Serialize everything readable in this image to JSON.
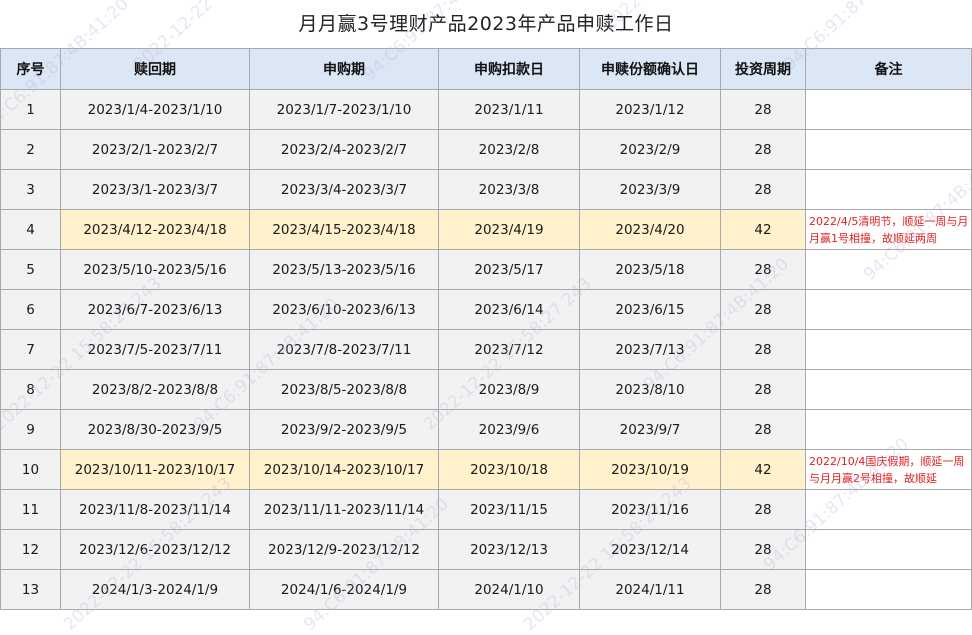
{
  "title": "月月赢3号理财产品2023年产品申赎工作日",
  "headers": {
    "seq": "序号",
    "redeem_period": "赎回期",
    "subscribe_period": "申购期",
    "debit_date": "申购扣款日",
    "confirm_date": "申赎份额确认日",
    "cycle": "投资周期",
    "remark": "备注"
  },
  "rows": [
    {
      "seq": "1",
      "redeem": "2023/1/4-2023/1/10",
      "subscribe": "2023/1/7-2023/1/10",
      "debit": "2023/1/11",
      "confirm": "2023/1/12",
      "cycle": "28",
      "remark": ""
    },
    {
      "seq": "2",
      "redeem": "2023/2/1-2023/2/7",
      "subscribe": "2023/2/4-2023/2/7",
      "debit": "2023/2/8",
      "confirm": "2023/2/9",
      "cycle": "28",
      "remark": ""
    },
    {
      "seq": "3",
      "redeem": "2023/3/1-2023/3/7",
      "subscribe": "2023/3/4-2023/3/7",
      "debit": "2023/3/8",
      "confirm": "2023/3/9",
      "cycle": "28",
      "remark": ""
    },
    {
      "seq": "4",
      "redeem": "2023/4/12-2023/4/18",
      "subscribe": "2023/4/15-2023/4/18",
      "debit": "2023/4/19",
      "confirm": "2023/4/20",
      "cycle": "42",
      "remark": "2022/4/5清明节，顺延一周与月月赢1号相撞，故顺延两周",
      "highlight": true
    },
    {
      "seq": "5",
      "redeem": "2023/5/10-2023/5/16",
      "subscribe": "2023/5/13-2023/5/16",
      "debit": "2023/5/17",
      "confirm": "2023/5/18",
      "cycle": "28",
      "remark": ""
    },
    {
      "seq": "6",
      "redeem": "2023/6/7-2023/6/13",
      "subscribe": "2023/6/10-2023/6/13",
      "debit": "2023/6/14",
      "confirm": "2023/6/15",
      "cycle": "28",
      "remark": ""
    },
    {
      "seq": "7",
      "redeem": "2023/7/5-2023/7/11",
      "subscribe": "2023/7/8-2023/7/11",
      "debit": "2023/7/12",
      "confirm": "2023/7/13",
      "cycle": "28",
      "remark": ""
    },
    {
      "seq": "8",
      "redeem": "2023/8/2-2023/8/8",
      "subscribe": "2023/8/5-2023/8/8",
      "debit": "2023/8/9",
      "confirm": "2023/8/10",
      "cycle": "28",
      "remark": ""
    },
    {
      "seq": "9",
      "redeem": "2023/8/30-2023/9/5",
      "subscribe": "2023/9/2-2023/9/5",
      "debit": "2023/9/6",
      "confirm": "2023/9/7",
      "cycle": "28",
      "remark": ""
    },
    {
      "seq": "10",
      "redeem": "2023/10/11-2023/10/17",
      "subscribe": "2023/10/14-2023/10/17",
      "debit": "2023/10/18",
      "confirm": "2023/10/19",
      "cycle": "42",
      "remark": "2022/10/4国庆假期，顺延一周与月月赢2号相撞，故顺延",
      "highlight": true
    },
    {
      "seq": "11",
      "redeem": "2023/11/8-2023/11/14",
      "subscribe": "2023/11/11-2023/11/14",
      "debit": "2023/11/15",
      "confirm": "2023/11/16",
      "cycle": "28",
      "remark": ""
    },
    {
      "seq": "12",
      "redeem": "2023/12/6-2023/12/12",
      "subscribe": "2023/12/9-2023/12/12",
      "debit": "2023/12/13",
      "confirm": "2023/12/14",
      "cycle": "28",
      "remark": ""
    },
    {
      "seq": "13",
      "redeem": "2024/1/3-2024/1/9",
      "subscribe": "2024/1/6-2024/1/9",
      "debit": "2024/1/10",
      "confirm": "2024/1/11",
      "cycle": "28",
      "remark": ""
    }
  ],
  "watermarks": [
    "94:C6:91:87:4B:41:20",
    "2022-12-22 15:58:27 243",
    "94:C6:91:87:4B:41:20",
    "2022-12-22 15:58:27 243",
    "94:C6:91:87:4B:41:20",
    "2022-12-22 15:58:27 243",
    "94:C6:91:87:4B:41:20",
    "2022-12-22 15:58:27 243",
    "94:C6:91:87:4B:41:20"
  ],
  "colors": {
    "header_bg": "#dbe7f4",
    "row_bg": "#f2f2f2",
    "highlight_bg": "#fff2cc",
    "remark_text": "#e02020",
    "border": "#a9a9a9"
  }
}
